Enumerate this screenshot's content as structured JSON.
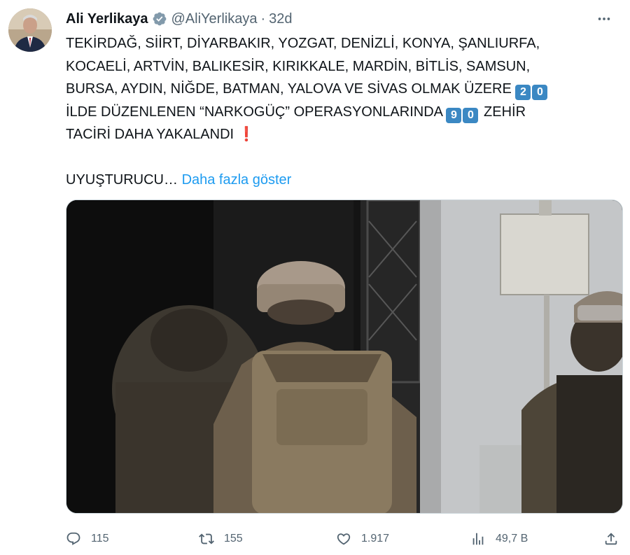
{
  "author": {
    "name": "Ali Yerlikaya",
    "handle": "@AliYerlikaya",
    "separator": "·",
    "time": "32d"
  },
  "tweet": {
    "lines": [
      "TEKİRDAĞ, SİİRT, DİYARBAKIR, YOZGAT, DENİZLİ, KONYA, ŞANLIURFA,",
      "KOCAELİ, ARTVİN, BALIKESİR, KIRIKKALE, MARDİN, BİTLİS, SAMSUN,",
      "BURSA, AYDIN, NİĞDE, BATMAN, YALOVA VE SİVAS OLMAK ÜZERE"
    ],
    "keycap_a": [
      "2",
      "0"
    ],
    "line4_text": "İLDE DÜZENLENEN “NARKOGÜÇ” OPERASYONLARINDA",
    "keycap_b": [
      "9",
      "0"
    ],
    "line4_tail": "ZEHİR",
    "line5_text": "TACİRİ DAHA YAKALANDI",
    "exclamation": "❗",
    "truncated": "UYUŞTURUCU…",
    "show_more": "Daha fazla göster"
  },
  "actions": {
    "replies": "115",
    "retweets": "155",
    "likes": "1.917",
    "views": "49,7 B"
  },
  "icons": {
    "verified": "verified-badge-icon",
    "more": "more-icon",
    "reply": "reply-icon",
    "retweet": "retweet-icon",
    "like": "heart-icon",
    "views": "views-icon",
    "share": "share-icon"
  },
  "colors": {
    "link": "#1d9bf0",
    "muted": "#536471",
    "keycap": "#3b88c3",
    "exclamation": "#dd2e44"
  }
}
